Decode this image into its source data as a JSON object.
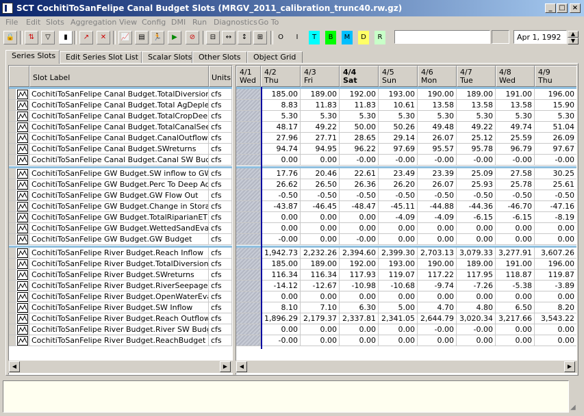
{
  "window": {
    "title": "SCT CochitiToSanFelipe Canal Budget Slots (MRGV_2011_calibration_trunc40.rw.gz)",
    "minimize_glyph": "_",
    "maximize_glyph": "□",
    "close_glyph": "×"
  },
  "menu": [
    "File",
    "Edit",
    "Slots",
    "Aggregation",
    "View",
    "Config",
    "DMI",
    "Run",
    "Diagnostics",
    "Go To"
  ],
  "toolbar": {
    "letter_buttons": [
      "O",
      "I",
      "T",
      "B",
      "M",
      "D",
      "R"
    ],
    "letter_colors": [
      "#d4d0c8",
      "#d4d0c8",
      "#00ffff",
      "#00ff00",
      "#00bfff",
      "#ffff66",
      "#c8ffc8"
    ],
    "date": "Apr 1, 1992"
  },
  "tabs": [
    "Series Slots",
    "Edit Series Slot List",
    "Scalar Slots",
    "Other Slots",
    "Object Grid"
  ],
  "table": {
    "label_header": "Slot Label",
    "units_header": "Units",
    "dates": [
      {
        "d": "4/1",
        "w": "Wed"
      },
      {
        "d": "4/2",
        "w": "Thu"
      },
      {
        "d": "4/3",
        "w": "Fri"
      },
      {
        "d": "4/4",
        "w": "Sat"
      },
      {
        "d": "4/5",
        "w": "Sun"
      },
      {
        "d": "4/6",
        "w": "Mon"
      },
      {
        "d": "4/7",
        "w": "Tue"
      },
      {
        "d": "4/8",
        "w": "Wed"
      },
      {
        "d": "4/9",
        "w": "Thu"
      }
    ],
    "groups": [
      [
        {
          "label": "CochitiToSanFelipe Canal Budget.TotalDiversion",
          "units": "cfs",
          "values": [
            "185.00",
            "189.00",
            "192.00",
            "193.00",
            "190.00",
            "189.00",
            "191.00",
            "196.00"
          ]
        },
        {
          "label": "CochitiToSanFelipe Canal Budget.Total AgDepletions",
          "units": "cfs",
          "values": [
            "8.83",
            "11.83",
            "11.83",
            "10.61",
            "13.58",
            "13.58",
            "13.58",
            "15.90"
          ]
        },
        {
          "label": "CochitiToSanFelipe Canal Budget.TotalCropDeepPerc",
          "units": "cfs",
          "values": [
            "5.30",
            "5.30",
            "5.30",
            "5.30",
            "5.30",
            "5.30",
            "5.30",
            "5.30"
          ]
        },
        {
          "label": "CochitiToSanFelipe Canal Budget.TotalCanalSeepage",
          "units": "cfs",
          "values": [
            "48.17",
            "49.22",
            "50.00",
            "50.26",
            "49.48",
            "49.22",
            "49.74",
            "51.04"
          ]
        },
        {
          "label": "CochitiToSanFelipe Canal Budget.CanalOutflow",
          "units": "cfs",
          "values": [
            "27.96",
            "27.71",
            "28.65",
            "29.14",
            "26.07",
            "25.12",
            "25.59",
            "26.09"
          ]
        },
        {
          "label": "CochitiToSanFelipe Canal Budget.SWreturns",
          "units": "cfs",
          "values": [
            "94.74",
            "94.95",
            "96.22",
            "97.69",
            "95.57",
            "95.78",
            "96.79",
            "97.67"
          ]
        },
        {
          "label": "CochitiToSanFelipe Canal Budget.Canal SW Budget",
          "units": "cfs",
          "values": [
            "0.00",
            "0.00",
            "-0.00",
            "-0.00",
            "-0.00",
            "-0.00",
            "-0.00",
            "-0.00"
          ]
        }
      ],
      [
        {
          "label": "CochitiToSanFelipe GW Budget.SW inflow to GW",
          "units": "cfs",
          "values": [
            "17.76",
            "20.46",
            "22.61",
            "23.49",
            "23.39",
            "25.09",
            "27.58",
            "30.25"
          ]
        },
        {
          "label": "CochitiToSanFelipe GW Budget.Perc To Deep Aquifer",
          "units": "cfs",
          "values": [
            "26.62",
            "26.50",
            "26.36",
            "26.20",
            "26.07",
            "25.93",
            "25.78",
            "25.61"
          ]
        },
        {
          "label": "CochitiToSanFelipe GW Budget.GW Flow Out",
          "units": "cfs",
          "values": [
            "-0.50",
            "-0.50",
            "-0.50",
            "-0.50",
            "-0.50",
            "-0.50",
            "-0.50",
            "-0.50"
          ]
        },
        {
          "label": "CochitiToSanFelipe GW Budget.Change in Storage",
          "units": "cfs",
          "values": [
            "-43.87",
            "-46.45",
            "-48.47",
            "-45.11",
            "-44.88",
            "-44.36",
            "-46.70",
            "-47.16"
          ]
        },
        {
          "label": "CochitiToSanFelipe GW Budget.TotalRiparianET",
          "units": "cfs",
          "values": [
            "0.00",
            "0.00",
            "0.00",
            "-4.09",
            "-4.09",
            "-6.15",
            "-6.15",
            "-8.19"
          ]
        },
        {
          "label": "CochitiToSanFelipe GW Budget.WettedSandEvap",
          "units": "cfs",
          "values": [
            "0.00",
            "0.00",
            "0.00",
            "0.00",
            "0.00",
            "0.00",
            "0.00",
            "0.00"
          ]
        },
        {
          "label": "CochitiToSanFelipe GW Budget.GW Budget",
          "units": "cfs",
          "values": [
            "-0.00",
            "0.00",
            "-0.00",
            "0.00",
            "0.00",
            "0.00",
            "0.00",
            "0.00"
          ]
        }
      ],
      [
        {
          "label": "CochitiToSanFelipe River Budget.Reach Inflow",
          "units": "cfs",
          "values": [
            "1,942.73",
            "2,232.26",
            "2,394.60",
            "2,399.30",
            "2,703.13",
            "3,079.33",
            "3,277.91",
            "3,607.26"
          ]
        },
        {
          "label": "CochitiToSanFelipe River Budget.TotalDiversion",
          "units": "cfs",
          "values": [
            "185.00",
            "189.00",
            "192.00",
            "193.00",
            "190.00",
            "189.00",
            "191.00",
            "196.00"
          ]
        },
        {
          "label": "CochitiToSanFelipe River Budget.SWreturns",
          "units": "cfs",
          "values": [
            "116.34",
            "116.34",
            "117.93",
            "119.07",
            "117.22",
            "117.95",
            "118.87",
            "119.87"
          ]
        },
        {
          "label": "CochitiToSanFelipe River Budget.RiverSeepage",
          "units": "cfs",
          "values": [
            "-14.12",
            "-12.67",
            "-10.98",
            "-10.68",
            "-9.74",
            "-7.26",
            "-5.38",
            "-3.89"
          ]
        },
        {
          "label": "CochitiToSanFelipe River Budget.OpenWaterEvap",
          "units": "cfs",
          "values": [
            "0.00",
            "0.00",
            "0.00",
            "0.00",
            "0.00",
            "0.00",
            "0.00",
            "0.00"
          ]
        },
        {
          "label": "CochitiToSanFelipe River Budget.SW Inflow",
          "units": "cfs",
          "values": [
            "8.10",
            "7.10",
            "6.30",
            "5.00",
            "4.70",
            "4.80",
            "6.50",
            "8.20"
          ]
        },
        {
          "label": "CochitiToSanFelipe River Budget.Reach Outflow",
          "units": "cfs",
          "values": [
            "1,896.29",
            "2,179.37",
            "2,337.81",
            "2,341.05",
            "2,644.79",
            "3,020.34",
            "3,217.66",
            "3,543.22"
          ]
        },
        {
          "label": "CochitiToSanFelipe River Budget.River SW Budget",
          "units": "cfs",
          "values": [
            "0.00",
            "0.00",
            "0.00",
            "0.00",
            "-0.00",
            "-0.00",
            "0.00",
            "0.00"
          ]
        },
        {
          "label": "CochitiToSanFelipe River Budget.ReachBudget",
          "units": "cfs",
          "values": [
            "-0.00",
            "0.00",
            "0.00",
            "0.00",
            "0.00",
            "0.00",
            "0.00",
            "0.00"
          ]
        }
      ]
    ]
  }
}
